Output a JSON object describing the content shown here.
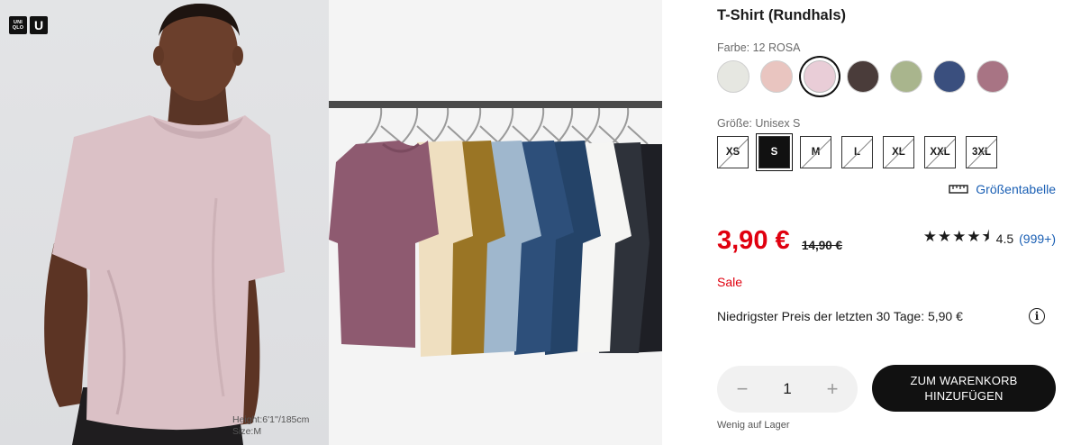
{
  "brand": {
    "logo_small": "UNI QLO",
    "logo_big": "U"
  },
  "model_photo": {
    "caption_height": "Height:6'1''/185cm",
    "caption_size": "Size:M"
  },
  "product": {
    "title": "T-Shirt (Rundhals)"
  },
  "color": {
    "label": "Farbe: 12 ROSA",
    "swatches": [
      {
        "name": "offwhite",
        "hex": "#e6e7e1"
      },
      {
        "name": "light-pink",
        "hex": "#e9c5c0"
      },
      {
        "name": "rosa",
        "hex": "#e9cdd7",
        "selected": true
      },
      {
        "name": "dark-brown",
        "hex": "#4a3c3a"
      },
      {
        "name": "olive",
        "hex": "#a9b58d"
      },
      {
        "name": "navy",
        "hex": "#3a4f7e"
      },
      {
        "name": "mauve",
        "hex": "#a87484"
      }
    ]
  },
  "size": {
    "label": "Größe: Unisex S",
    "options": [
      {
        "label": "XS",
        "available": false
      },
      {
        "label": "S",
        "selected": true
      },
      {
        "label": "M",
        "available": false
      },
      {
        "label": "L",
        "available": false
      },
      {
        "label": "XL",
        "available": false
      },
      {
        "label": "XXL",
        "available": false
      },
      {
        "label": "3XL",
        "available": false
      }
    ],
    "chart_link": "Größentabelle"
  },
  "price": {
    "sale": "3,90 €",
    "original": "14,90 €",
    "sale_badge": "Sale",
    "lowest_note": "Niedrigster Preis der letzten 30 Tage: 5,90 €"
  },
  "rating": {
    "stars": "★★★★⯨",
    "value": "4.5",
    "count": "(999+)"
  },
  "quantity": {
    "value": "1",
    "minus": "−",
    "plus": "+"
  },
  "cart": {
    "line1": "ZUM WARENKORB",
    "line2": "HINZUFÜGEN"
  },
  "stock": {
    "note": "Wenig auf Lager"
  },
  "colors": {
    "accent_red": "#e0000f",
    "link_blue": "#1a5fb4",
    "button_black": "#111111"
  }
}
